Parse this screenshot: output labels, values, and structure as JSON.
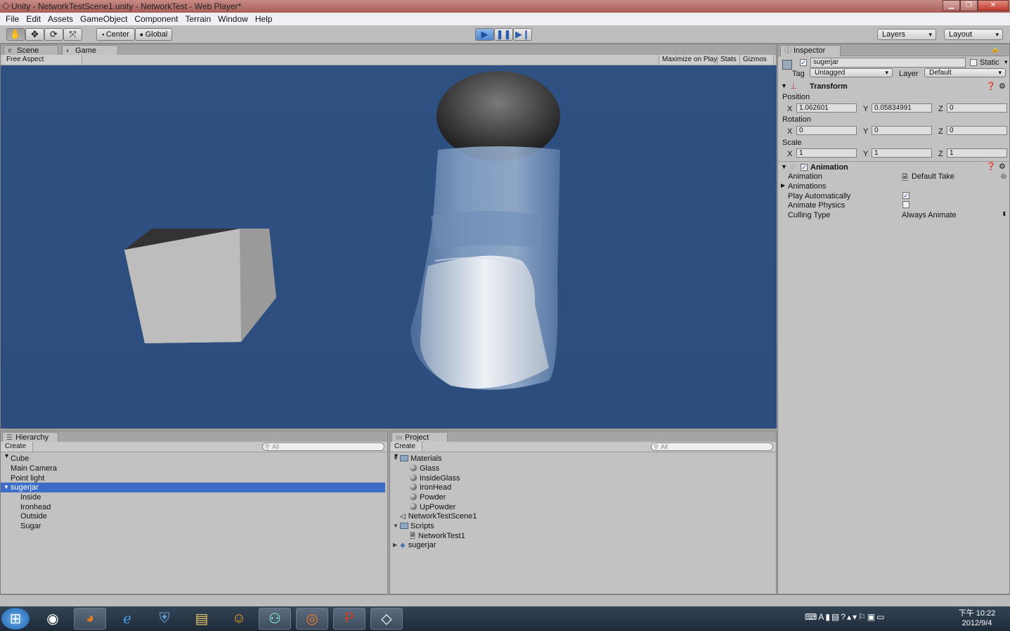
{
  "window": {
    "title": "Unity - NetworkTestScene1.unity - NetworkTest - Web Player*"
  },
  "menu": [
    "File",
    "Edit",
    "Assets",
    "GameObject",
    "Component",
    "Terrain",
    "Window",
    "Help"
  ],
  "toolbar": {
    "pivot": "Center",
    "space": "Global",
    "layers": "Layers",
    "layout": "Layout"
  },
  "scene_tabs": {
    "scene": "Scene",
    "game": "Game"
  },
  "game_bar": {
    "aspect": "Free Aspect",
    "maximize": "Maximize on Play",
    "stats": "Stats",
    "gizmos": "Gizmos"
  },
  "colors": {
    "viewport": "#2f5081",
    "selection": "#3d6cc8",
    "panel": "#c2c2c2"
  },
  "hierarchy": {
    "title": "Hierarchy",
    "create": "Create",
    "search": "All",
    "items": [
      {
        "label": "Cube"
      },
      {
        "label": "Main Camera"
      },
      {
        "label": "Point light"
      },
      {
        "label": "sugerjar"
      },
      {
        "label": "Inside"
      },
      {
        "label": "Ironhead"
      },
      {
        "label": "Outside"
      },
      {
        "label": "Sugar"
      }
    ]
  },
  "project": {
    "title": "Project",
    "create": "Create",
    "search": "All",
    "items": [
      {
        "label": "Materials"
      },
      {
        "label": "Glass"
      },
      {
        "label": "InsideGlass"
      },
      {
        "label": "IronHead"
      },
      {
        "label": "Powder"
      },
      {
        "label": "UpPowder"
      },
      {
        "label": "NetworkTestScene1"
      },
      {
        "label": "Scripts"
      },
      {
        "label": "NetworkTest1"
      },
      {
        "label": "sugerjar"
      }
    ]
  },
  "inspector": {
    "title": "Inspector",
    "object_name": "sugerjar",
    "static_label": "Static",
    "tag_label": "Tag",
    "tag_value": "Untagged",
    "layer_label": "Layer",
    "layer_value": "Default",
    "transform": {
      "title": "Transform",
      "position_label": "Position",
      "rotation_label": "Rotation",
      "scale_label": "Scale",
      "axis_x": "X",
      "axis_y": "Y",
      "axis_z": "Z",
      "position": {
        "x": "1.062601",
        "y": "0.05834991",
        "z": "0"
      },
      "rotation": {
        "x": "0",
        "y": "0",
        "z": "0"
      },
      "scale": {
        "x": "1",
        "y": "1",
        "z": "1"
      }
    },
    "animation": {
      "title": "Animation",
      "animation_label": "Animation",
      "animation_value": "Default Take",
      "animations_label": "Animations",
      "play_auto_label": "Play Automatically",
      "play_auto": true,
      "physics_label": "Animate Physics",
      "physics": false,
      "culling_label": "Culling Type",
      "culling_value": "Always Animate"
    }
  },
  "taskbar": {
    "time": "下午 10:22",
    "date": "2012/9/4"
  }
}
